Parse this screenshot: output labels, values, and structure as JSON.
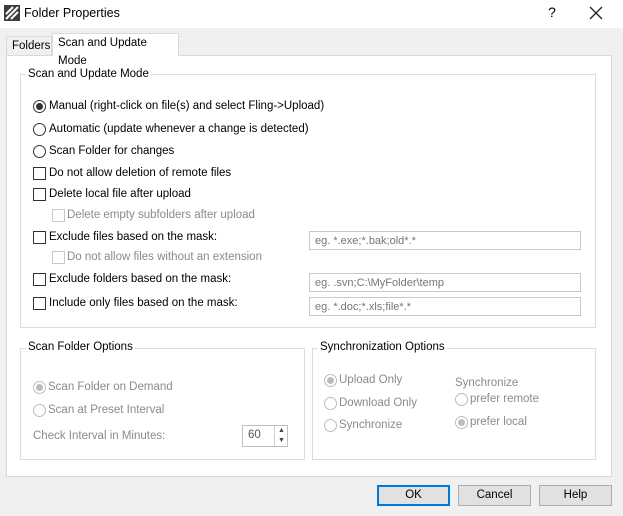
{
  "window": {
    "title": "Folder Properties",
    "help_label": "?"
  },
  "tabs": [
    {
      "label": "Folders"
    },
    {
      "label": "Scan and Update Mode"
    }
  ],
  "scan_update_group": {
    "title": "Scan and Update Mode",
    "radio_manual": "Manual (right-click on file(s) and select Fling->Upload)",
    "radio_automatic": "Automatic (update whenever a change is detected)",
    "radio_scan_folder": "Scan Folder for changes",
    "chk_no_delete_remote": "Do not allow deletion of remote files",
    "chk_delete_local": "Delete local file after upload",
    "chk_delete_empty_subfolders": "Delete empty subfolders after upload",
    "chk_exclude_files": "Exclude files based on the mask:",
    "exclude_files_placeholder": "eg. *.exe;*.bak;old*.*",
    "chk_no_ext": "Do not allow files without an extension",
    "chk_exclude_folders": "Exclude folders based on the mask:",
    "exclude_folders_placeholder": "eg. .svn;C:\\MyFolder\\temp",
    "chk_include_only": "Include only files based on the mask:",
    "include_only_placeholder": "eg. *.doc;*.xls;file*.*"
  },
  "scan_folder_options": {
    "title": "Scan Folder Options",
    "radio_on_demand": "Scan Folder on Demand",
    "radio_preset": "Scan at Preset Interval",
    "interval_label": "Check Interval in Minutes:",
    "interval_value": "60"
  },
  "sync_options": {
    "title": "Synchronization Options",
    "radio_upload_only": "Upload Only",
    "radio_download_only": "Download Only",
    "radio_synchronize": "Synchronize",
    "sync_sub_label": "Synchronize",
    "radio_prefer_remote": "prefer remote",
    "radio_prefer_local": "prefer local"
  },
  "buttons": {
    "ok": "OK",
    "cancel": "Cancel",
    "help": "Help"
  },
  "colors": {
    "accent": "#0078d7",
    "disabled_text": "#8a8a8a"
  }
}
